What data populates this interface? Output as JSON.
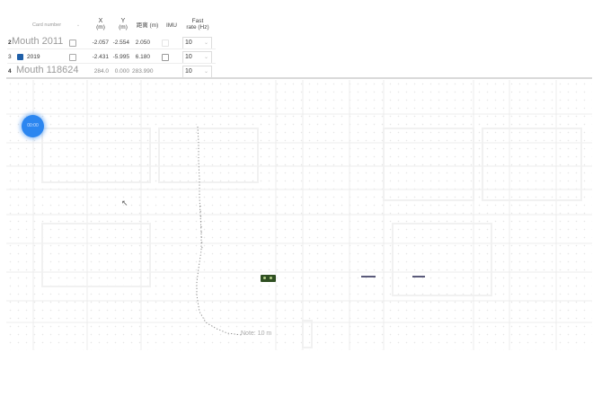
{
  "table": {
    "columns": {
      "card": "Card number",
      "x_top": "X",
      "x_unit": "(m)",
      "y_top": "Y",
      "y_unit": "(m)",
      "distance": "距离 (m)",
      "imu": "IMU",
      "rate_top": "Fast",
      "rate_bottom": "rate (Hz)"
    },
    "rows": [
      {
        "index": "2",
        "name": "Mouth 2011",
        "x": "-2.057",
        "y": "-2.554",
        "distance": "2.050",
        "rate": "10",
        "imu_checked": false
      },
      {
        "index": "3",
        "name": "2019",
        "x": "-2.431",
        "y": "-5.995",
        "distance": "6.180",
        "rate": "10",
        "imu_checked": false
      },
      {
        "index": "4",
        "name": "Mouth 118624",
        "x": "284.0",
        "y": "0.000",
        "distance": "283.990",
        "rate": "10",
        "imu_checked": false
      }
    ]
  },
  "map": {
    "bubble_text": "00:00",
    "scale_label": "Note: 10 m",
    "accent_color": "#2b86f0",
    "anchor_color": "#2f4f22"
  }
}
